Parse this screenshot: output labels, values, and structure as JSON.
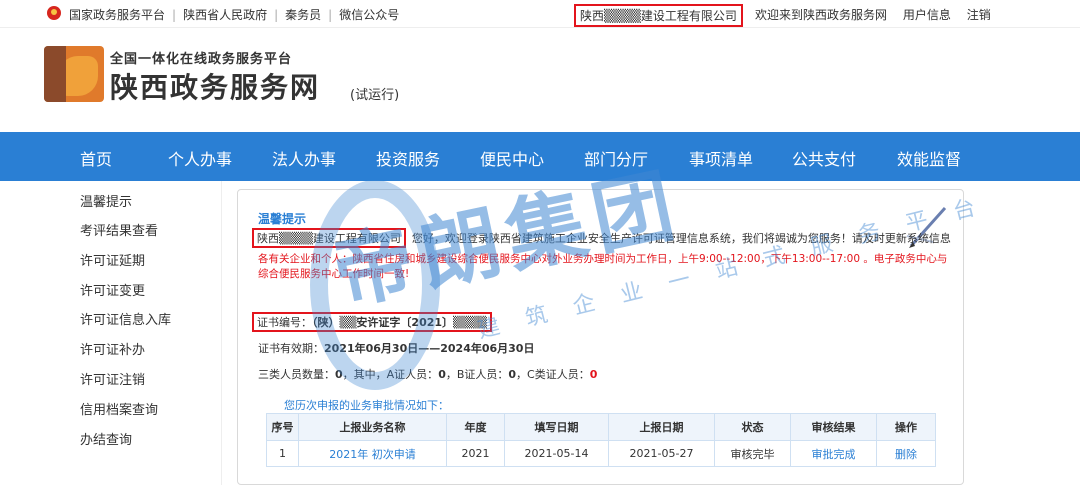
{
  "topbar": {
    "links": [
      "国家政务服务平台",
      "陕西省人民政府",
      "秦务员",
      "微信公众号"
    ],
    "company": "陕西▒▒▒▒建设工程有限公司",
    "welcome": "欢迎来到陕西政务服务网",
    "user_info": "用户信息",
    "logout": "注销"
  },
  "header": {
    "subtitle": "全国一体化在线政务服务平台",
    "title": "陕西政务服务网",
    "trial": "(试运行)"
  },
  "nav": [
    "首页",
    "个人办事",
    "法人办事",
    "投资服务",
    "便民中心",
    "部门分厅",
    "事项清单",
    "公共支付",
    "效能监督"
  ],
  "watermark": {
    "main": "帝朗集团",
    "sub": "建 筑 企 业 一 站 式 服 务 平 台"
  },
  "sidebar": [
    "温馨提示",
    "考评结果查看",
    "许可证延期",
    "许可证变更",
    "许可证信息入库",
    "许可证补办",
    "许可证注销",
    "信用档案查询",
    "办结查询"
  ],
  "panel": {
    "heading": "温馨提示",
    "company": "陕西▒▒▒▒建设工程有限公司",
    "greeting": "您好，欢迎登录陕西省建筑施工企业安全生产许可证管理信息系统，我们将竭诚为您服务！请及时更新系统信息",
    "notice": "各有关企业和个人：陕西省住房和城乡建设综合便民服务中心对外业务办理时间为工作日，上午9:00--12:00，下午13:00--17:00 。电子政务中心与综合便民服务中心工作时间一致!",
    "cert_label": "证书编号：",
    "cert_value": "（陕）▒▒安许证字〔2021〕▒▒▒▒",
    "validity_label": "证书有效期：",
    "validity_value": "2021年06月30日——2024年06月30日",
    "personnel": {
      "label": "三类人员数量：",
      "total": "0",
      "a_label": "，其中，A证人员：",
      "a": "0",
      "b_label": "，B证人员：",
      "b": "0",
      "c_label": "，C类证人员：",
      "c": "0"
    },
    "history_caption": "您历次申报的业务审批情况如下：",
    "table": {
      "headers": [
        "序号",
        "上报业务名称",
        "年度",
        "填写日期",
        "上报日期",
        "状态",
        "审核结果",
        "操作"
      ],
      "rows": [
        [
          "1",
          "2021年 初次申请",
          "2021",
          "2021-05-14",
          "2021-05-27",
          "审核完毕",
          "审批完成",
          "删除"
        ]
      ]
    }
  },
  "colors": {
    "nav_bg": "#2a7fd4",
    "highlight_box": "#e3141c",
    "notice_text": "#e3141c",
    "link_blue": "#2a7fd4"
  }
}
